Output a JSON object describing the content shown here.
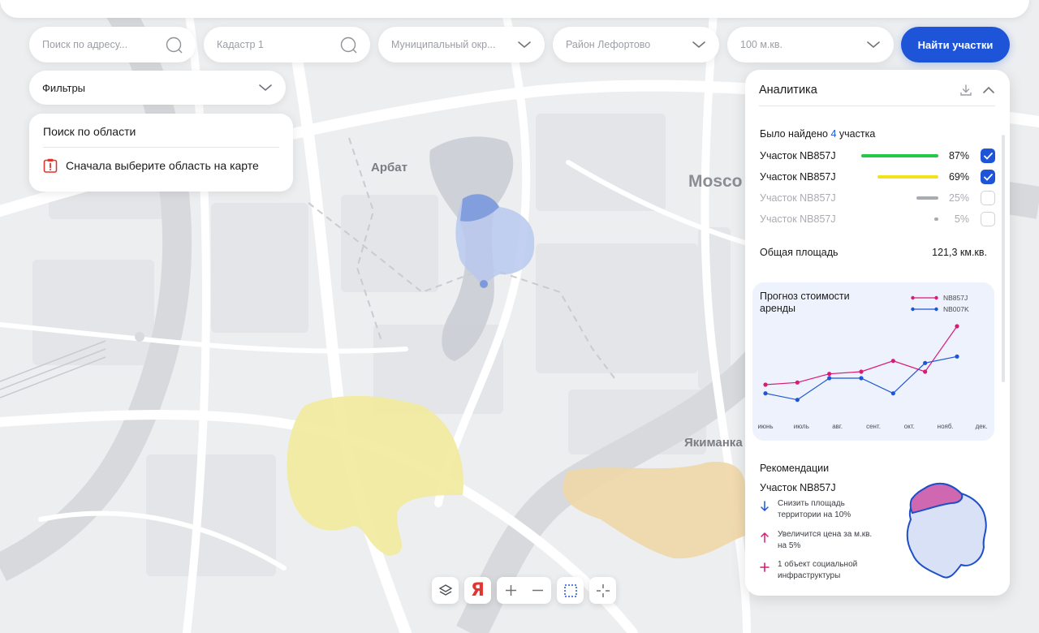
{
  "search": {
    "address_placeholder": "Поиск по адресу...",
    "cadastre_placeholder": "Кадастр 1",
    "municipal_district": "Муниципальный окр...",
    "district": "Район Лефортово",
    "area": "100 м.кв.",
    "find_button": "Найти участки"
  },
  "filters": {
    "label": "Фильтры"
  },
  "area_search": {
    "title": "Поиск по области",
    "warning": "Сначала выберите область на карте"
  },
  "map": {
    "labels": [
      "Арбат",
      "Mosco",
      "Якиманка"
    ]
  },
  "analytics": {
    "title": "Аналитика",
    "found_prefix": "Было найдено",
    "found_count": "4",
    "found_suffix": "участка",
    "plots": [
      {
        "name": "Участок NB857J",
        "percent": "87%",
        "value": 87,
        "color": "#22c84a",
        "checked": true
      },
      {
        "name": "Участок NB857J",
        "percent": "69%",
        "value": 69,
        "color": "#f2e21c",
        "checked": true
      },
      {
        "name": "Участок NB857J",
        "percent": "25%",
        "value": 25,
        "color": "#a8abb2",
        "checked": false
      },
      {
        "name": "Участок NB857J",
        "percent": "5%",
        "value": 5,
        "color": "#a8abb2",
        "checked": false
      }
    ],
    "total_label": "Общая площадь",
    "total_value": "121,3 км.кв.",
    "forecast": {
      "title": "Прогноз стоимости аренды",
      "legend": [
        {
          "name": "NB857J",
          "color": "#d81b77"
        },
        {
          "name": "NB007K",
          "color": "#1e55d8"
        }
      ]
    },
    "recommendations": {
      "title": "Рекомендации",
      "plot": "Участок NB857J",
      "items": [
        {
          "icon": "arrow-down-icon",
          "text": "Снизить площадь территории на 10%",
          "color": "#1e55d8"
        },
        {
          "icon": "arrow-up-icon",
          "text": "Увеличится цена за м.кв. на 5%",
          "color": "#d81b77"
        },
        {
          "icon": "plus-icon",
          "text": "1 объект социальной инфраструктуры",
          "color": "#d81b77"
        }
      ]
    }
  },
  "chart_data": {
    "type": "line",
    "title": "Прогноз стоимости аренды",
    "categories": [
      "июнь",
      "июль",
      "авг.",
      "сент.",
      "окт.",
      "нояб.",
      "дек."
    ],
    "x": [
      0,
      0.5,
      1,
      1.5,
      2,
      2.5,
      3,
      3.5,
      4,
      4.5,
      5,
      5.5
    ],
    "series": [
      {
        "name": "NB857J",
        "color": "#d81b77",
        "values": [
          22,
          23,
          27,
          28,
          33,
          28,
          49
        ]
      },
      {
        "name": "NB007K",
        "color": "#1e55d8",
        "values": [
          18,
          15,
          25,
          25,
          18,
          32,
          35
        ]
      }
    ],
    "ylim": [
      10,
      55
    ],
    "grid": false,
    "legend": "top-right"
  }
}
